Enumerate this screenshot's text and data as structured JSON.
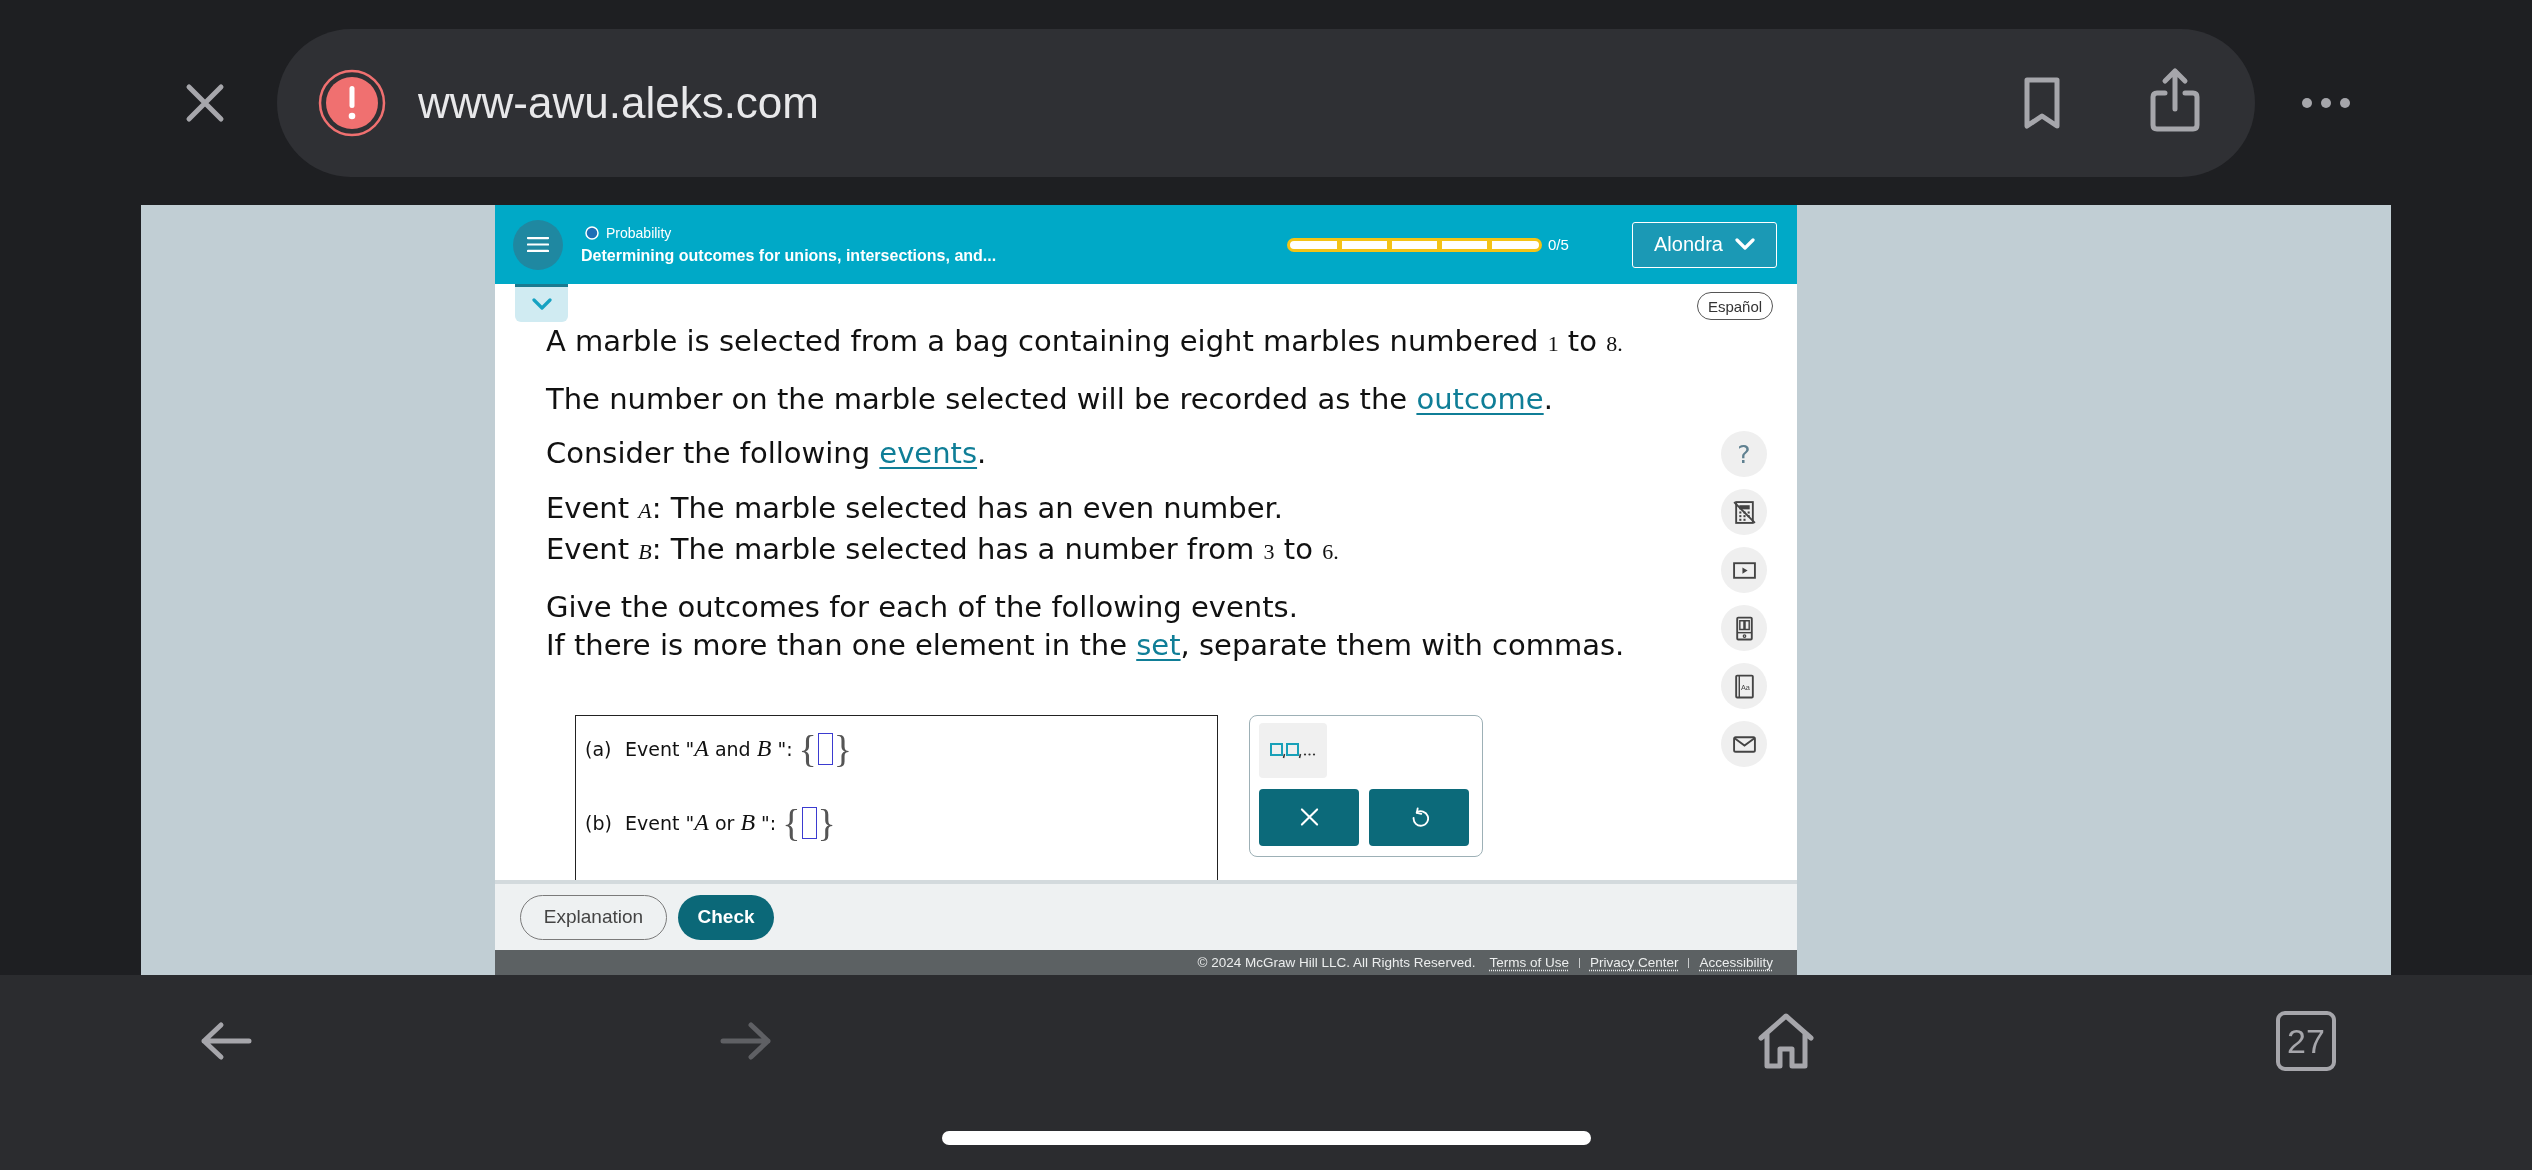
{
  "browser": {
    "url": "www-awu.aleks.com",
    "nav": [
      {
        "kind": "back",
        "disabled": false
      },
      {
        "kind": "forward",
        "disabled": true
      },
      {
        "kind": "home",
        "disabled": false
      }
    ],
    "tab_count": "27"
  },
  "header": {
    "topic": "Probability",
    "title": "Determining outcomes for unions, intersections, and...",
    "progress": {
      "level": 0,
      "reading": "0/5"
    },
    "user": "Alondra"
  },
  "language_button": "Español",
  "question": {
    "blocks": [
      {
        "lines": [
          [
            {
              "kind": "text",
              "text": "A marble is selected from a bag containing eight marbles numbered "
            },
            {
              "kind": "num",
              "text": "1"
            },
            {
              "kind": "text",
              "text": " to "
            },
            {
              "kind": "num",
              "text": "8."
            }
          ]
        ]
      },
      {
        "lines": [
          [
            {
              "kind": "text",
              "text": "The number on the marble selected will be recorded as the "
            },
            {
              "kind": "link",
              "text": "outcome"
            },
            {
              "kind": "text",
              "text": "."
            }
          ]
        ]
      },
      {
        "lines": [
          [
            {
              "kind": "text",
              "text": "Consider the following "
            },
            {
              "kind": "link",
              "text": "events"
            },
            {
              "kind": "text",
              "text": "."
            }
          ]
        ]
      },
      {
        "lines": [
          [
            {
              "kind": "text",
              "text": "Event "
            },
            {
              "kind": "var",
              "text": "A"
            },
            {
              "kind": "text",
              "text": ": The marble selected has an even number."
            }
          ],
          [
            {
              "kind": "text",
              "text": "Event "
            },
            {
              "kind": "var",
              "text": "B"
            },
            {
              "kind": "text",
              "text": ": The marble selected has a number from "
            },
            {
              "kind": "num",
              "text": "3"
            },
            {
              "kind": "text",
              "text": " to "
            },
            {
              "kind": "num",
              "text": "6."
            }
          ]
        ]
      },
      {
        "lines": [
          [
            {
              "kind": "text",
              "text": "Give the outcomes for each of the following events."
            }
          ],
          [
            {
              "kind": "text",
              "text": "If there is more than one element in the "
            },
            {
              "kind": "link",
              "text": "set"
            },
            {
              "kind": "text",
              "text": ", separate them with commas."
            }
          ]
        ]
      }
    ]
  },
  "tools": [
    {
      "kind": "help",
      "label": "?",
      "disabled": false
    },
    {
      "kind": "calculator",
      "disabled": true
    },
    {
      "kind": "video",
      "disabled": false
    },
    {
      "kind": "ebook",
      "disabled": false
    },
    {
      "kind": "dictionary",
      "label": "Aa",
      "disabled": false
    },
    {
      "kind": "mail",
      "disabled": false
    }
  ],
  "answers": [
    {
      "label": "(a)",
      "prompt": [
        {
          "kind": "text",
          "text": "Event \""
        },
        {
          "kind": "var",
          "text": "A"
        },
        {
          "kind": "text",
          "text": " and "
        },
        {
          "kind": "var",
          "text": "B"
        },
        {
          "kind": "text",
          "text": " \":"
        }
      ],
      "open_brace": "{",
      "close_brace": "}"
    },
    {
      "label": "(b)",
      "prompt": [
        {
          "kind": "text",
          "text": "Event \""
        },
        {
          "kind": "var",
          "text": "A"
        },
        {
          "kind": "text",
          "text": " or "
        },
        {
          "kind": "var",
          "text": "B"
        },
        {
          "kind": "text",
          "text": " \":"
        }
      ],
      "open_brace": "{",
      "close_brace": "}"
    }
  ],
  "keypad": [
    {
      "kind": "set_template"
    },
    {
      "kind": "clear"
    },
    {
      "kind": "undo"
    }
  ],
  "actions": [
    {
      "kind": "secondary",
      "label": "Explanation"
    },
    {
      "kind": "primary",
      "label": "Check"
    }
  ],
  "footer": {
    "copyright": "© 2024 McGraw Hill LLC. All Rights Reserved.",
    "links": [
      "Terms of Use",
      "Privacy Center",
      "Accessibility"
    ]
  }
}
